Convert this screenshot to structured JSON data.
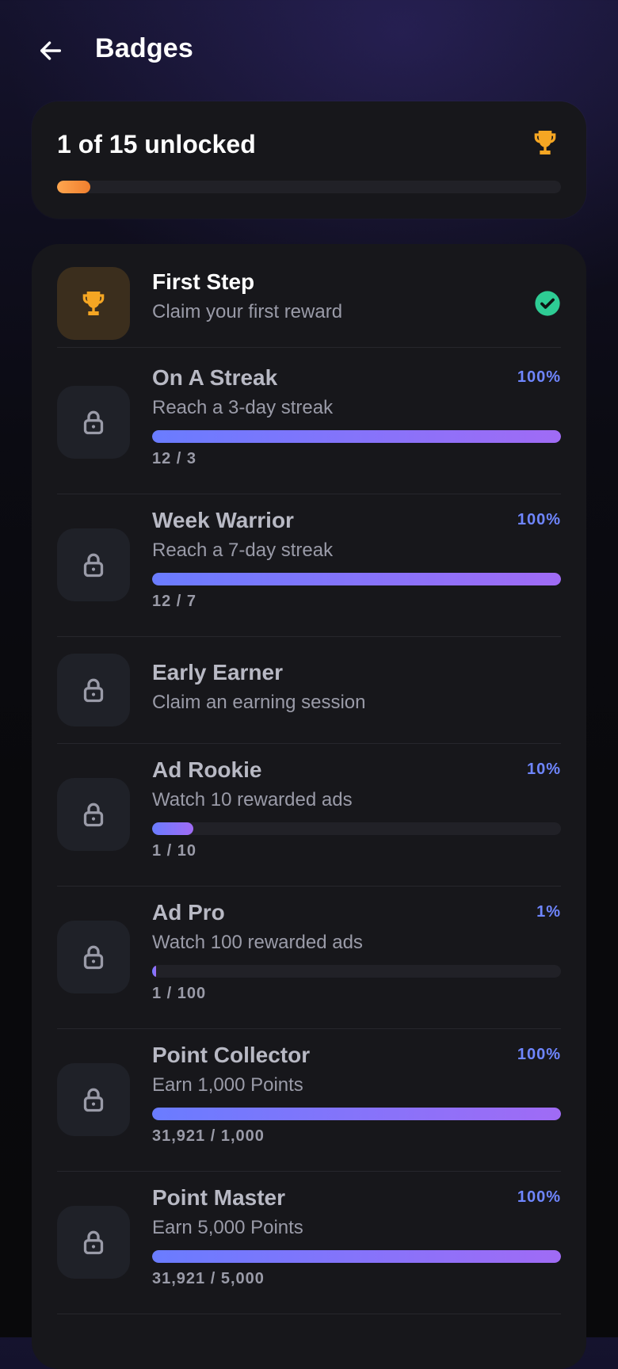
{
  "header": {
    "title": "Badges",
    "back_icon": "arrow-left-icon"
  },
  "summary": {
    "text": "1 of 15 unlocked",
    "progress": 0.0667,
    "icon": "trophy-icon"
  },
  "colors": {
    "accent_gold": "#f5a623",
    "accent_blue": "#6f86ff",
    "accent_purple": "#a06bf5",
    "success": "#2ecc94"
  },
  "badges": [
    {
      "title": "First Step",
      "desc": "Claim your first reward",
      "unlocked": true,
      "icon": "trophy-icon"
    },
    {
      "title": "On A Streak",
      "desc": "Reach a 3-day streak",
      "pct": "100%",
      "progress": 1.0,
      "count": "12 / 3",
      "icon": "lock-icon"
    },
    {
      "title": "Week Warrior",
      "desc": "Reach a 7-day streak",
      "pct": "100%",
      "progress": 1.0,
      "count": "12 / 7",
      "icon": "lock-icon"
    },
    {
      "title": "Early Earner",
      "desc": "Claim an earning session",
      "icon": "lock-icon"
    },
    {
      "title": "Ad Rookie",
      "desc": "Watch 10 rewarded ads",
      "pct": "10%",
      "progress": 0.1,
      "count": "1 / 10",
      "icon": "lock-icon"
    },
    {
      "title": "Ad Pro",
      "desc": "Watch 100 rewarded ads",
      "pct": "1%",
      "progress": 0.01,
      "count": "1 / 100",
      "icon": "lock-icon"
    },
    {
      "title": "Point Collector",
      "desc": "Earn 1,000 Points",
      "pct": "100%",
      "progress": 1.0,
      "count": "31,921 / 1,000",
      "icon": "lock-icon"
    },
    {
      "title": "Point Master",
      "desc": "Earn 5,000 Points",
      "pct": "100%",
      "progress": 1.0,
      "count": "31,921 / 5,000",
      "icon": "lock-icon"
    }
  ]
}
